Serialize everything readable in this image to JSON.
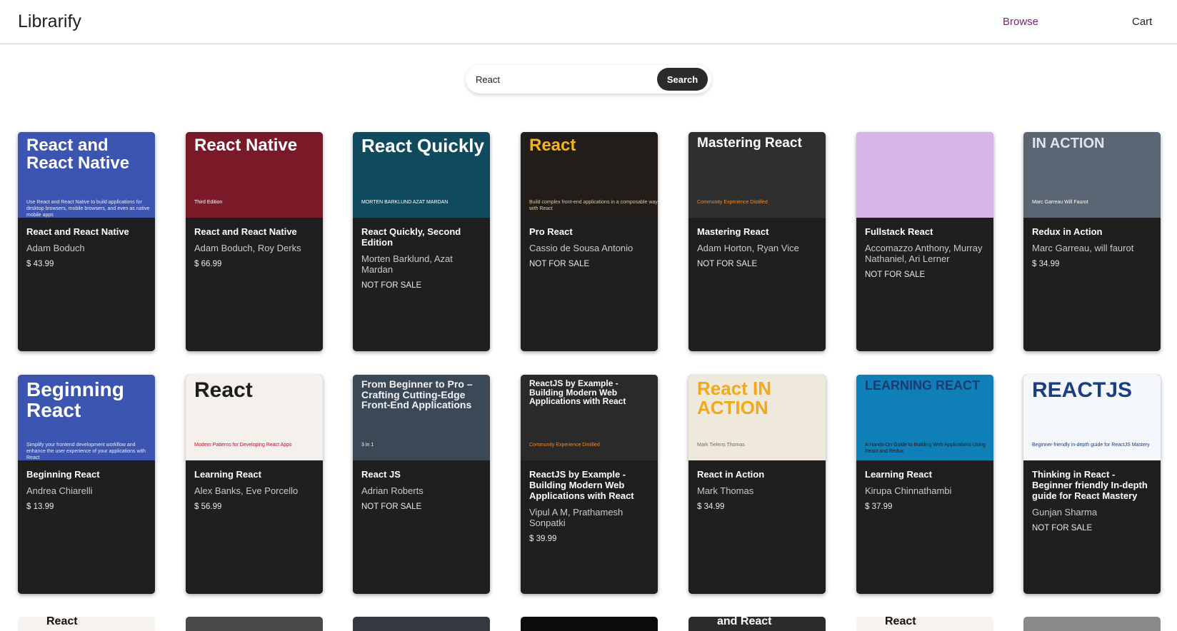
{
  "header": {
    "brand": "Librarify",
    "nav": {
      "browse": "Browse",
      "cart": "Cart"
    }
  },
  "search": {
    "value": "React",
    "button_label": "Search"
  },
  "books": [
    {
      "title": "React and React Native",
      "authors": "Adam Boduch",
      "price": "$ 43.99",
      "cover": {
        "bg": "#3c55b0",
        "title": "React and React Native",
        "title_color": "#ffffff",
        "title_size": 24,
        "sub": "Use React and React Native to build applications for desktop browsers, mobile browsers, and even as native mobile apps",
        "sub_color": "#e8ecff"
      }
    },
    {
      "title": "React and React Native",
      "authors": "Adam Boduch, Roy Derks",
      "price": "$ 66.99",
      "cover": {
        "bg": "#7a1a28",
        "title": "React Native",
        "title_color": "#ffffff",
        "title_size": 24,
        "sub": "Third Edition",
        "sub_color": "#ffffff"
      }
    },
    {
      "title": "React Quickly, Second Edition",
      "authors": "Morten Barklund, Azat Mardan",
      "price": "NOT FOR SALE",
      "cover": {
        "bg": "#0f4a5e",
        "title": "React Quickly",
        "title_color": "#ffffff",
        "title_size": 26,
        "sub": "MORTEN BARKLUND AZAT MARDAN",
        "sub_color": "#ffffff"
      }
    },
    {
      "title": "Pro React",
      "authors": "Cassio de Sousa Antonio",
      "price": "NOT FOR SALE",
      "cover": {
        "bg": "#231d1a",
        "title": "React",
        "title_color": "#f1b41f",
        "title_size": 24,
        "sub": "Build complex front-end applications in a composable way with React",
        "sub_color": "#d9c9a6"
      }
    },
    {
      "title": "Mastering React",
      "authors": "Adam Horton, Ryan Vice",
      "price": "NOT FOR SALE",
      "cover": {
        "bg": "#2f2f2f",
        "title": "Mastering React",
        "title_color": "#ffffff",
        "title_size": 19,
        "sub": "Community Experience Distilled",
        "sub_color": "#f08a2a"
      }
    },
    {
      "title": "Fullstack React",
      "authors": "Accomazzo Anthony, Murray Nathaniel, Ari Lerner",
      "price": "NOT FOR SALE",
      "cover": {
        "bg": "#d6b6e8",
        "title": "",
        "title_color": "#ffffff",
        "title_size": 20,
        "sub": "",
        "sub_color": "#ffffff"
      }
    },
    {
      "title": "Redux in Action",
      "authors": "Marc Garreau, will faurot",
      "price": "$ 34.99",
      "cover": {
        "bg": "#5b6674",
        "title": "IN ACTION",
        "title_color": "#dfe4ea",
        "title_size": 20,
        "sub": "Marc Garreau Will Faurot",
        "sub_color": "#ffffff"
      }
    },
    {
      "title": "Beginning React",
      "authors": "Andrea Chiarelli",
      "price": "$ 13.99",
      "cover": {
        "bg": "#3c55b0",
        "title": "Beginning React",
        "title_color": "#ffffff",
        "title_size": 28,
        "sub": "Simplify your frontend development workflow and enhance the user experience of your applications with React",
        "sub_color": "#e8ecff"
      }
    },
    {
      "title": "Learning React",
      "authors": "Alex Banks, Eve Porcello",
      "price": "$ 56.99",
      "cover": {
        "bg": "#f4f1ec",
        "title": "React",
        "title_color": "#1d1d1d",
        "title_size": 30,
        "sub": "Modern Patterns for Developing React Apps",
        "sub_color": "#b3122a"
      }
    },
    {
      "title": "React JS",
      "authors": "Adrian Roberts",
      "price": "NOT FOR SALE",
      "cover": {
        "bg": "#3b4957",
        "title": "From Beginner to Pro – Crafting Cutting-Edge Front-End Applications",
        "title_color": "#f3f3f3",
        "title_size": 14,
        "sub": "3 in 1",
        "sub_color": "#ffffff"
      }
    },
    {
      "title": "ReactJS by Example - Building Modern Web Applications with React",
      "authors": "Vipul A M, Prathamesh Sonpatki",
      "price": "$ 39.99",
      "cover": {
        "bg": "#2a2a2a",
        "title": "ReactJS by Example - Building Modern Web Applications with React",
        "title_color": "#ffffff",
        "title_size": 12,
        "sub": "Community Experience Distilled",
        "sub_color": "#f08a2a"
      }
    },
    {
      "title": "React in Action",
      "authors": "Mark Thomas",
      "price": "$ 34.99",
      "cover": {
        "bg": "#efe9dc",
        "title": "React IN ACTION",
        "title_color": "#f1a91b",
        "title_size": 26,
        "sub": "Mark Tielens Thomas",
        "sub_color": "#6b6b6b"
      }
    },
    {
      "title": "Learning React",
      "authors": "Kirupa Chinnathambi",
      "price": "$ 37.99",
      "cover": {
        "bg": "#0f7fb7",
        "title": "LEARNING REACT",
        "title_color": "#1d3b70",
        "title_size": 18,
        "sub": "A Hands-On Guide to Building Web Applications Using React and Redux",
        "sub_color": "#1d1d1d"
      }
    },
    {
      "title": "Thinking in React - Beginner friendly In-depth guide for React Mastery",
      "authors": "Gunjan Sharma",
      "price": "NOT FOR SALE",
      "cover": {
        "bg": "#f4f7fb",
        "title": "REACTJS",
        "title_color": "#1b3e82",
        "title_size": 30,
        "sub": "Beginner-friendly in-depth guide for ReactJS Mastery",
        "sub_color": "#1b3e82"
      }
    }
  ],
  "peek_row": [
    {
      "bg": "#f6f3ee",
      "label": "React",
      "label_color": "#111111"
    },
    {
      "bg": "#4a4a4a",
      "label": "",
      "label_color": "#ffffff"
    },
    {
      "bg": "#33393f",
      "label": "",
      "label_color": "#ffffff"
    },
    {
      "bg": "#0b0b0b",
      "label": "",
      "label_color": "#ffffff"
    },
    {
      "bg": "#2b2b2b",
      "label": "and React",
      "label_color": "#ffffff"
    },
    {
      "bg": "#f6f3ee",
      "label": "React",
      "label_color": "#111111"
    },
    {
      "bg": "#8a8a8a",
      "label": "",
      "label_color": "#ffffff"
    }
  ],
  "colors": {
    "card_bg": "#1f1f1f",
    "accent_nav": "#7a1f7a",
    "search_button": "#2b2b2e"
  }
}
